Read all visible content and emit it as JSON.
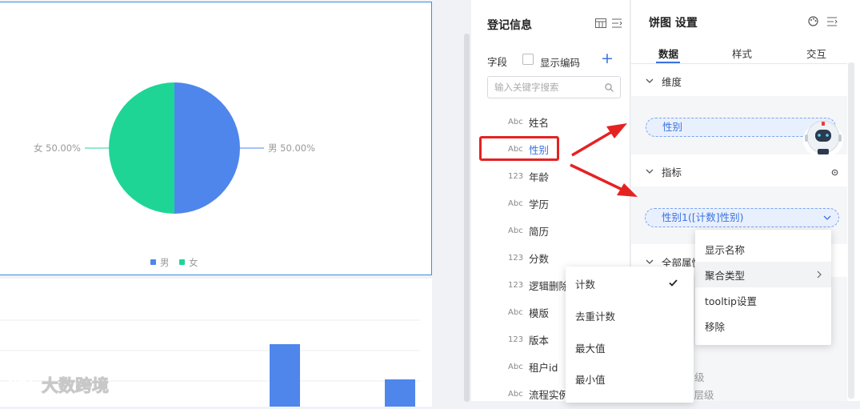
{
  "canvas": {
    "pie_chart": {
      "chart_data": {
        "type": "pie",
        "categories": [
          "男",
          "女"
        ],
        "values": [
          50,
          50
        ],
        "labels": [
          "男 50.00%",
          "女 50.00%"
        ],
        "colors": [
          "#4f86ec",
          "#1fd596"
        ],
        "legend_placement": "bottom",
        "legend": [
          "男",
          "女"
        ]
      }
    },
    "bar_chart": {
      "chart_data": {
        "type": "bar",
        "color": "#4f86ec",
        "note": "partially visible"
      }
    }
  },
  "field_panel": {
    "title": "登记信息",
    "section_label": "字段",
    "show_code_label": "显示编码",
    "search_placeholder": "输入关键字搜索",
    "fields": [
      {
        "type": "Abc",
        "name": "姓名"
      },
      {
        "type": "Abc",
        "name": "性别"
      },
      {
        "type": "123",
        "name": "年龄"
      },
      {
        "type": "Abc",
        "name": "学历"
      },
      {
        "type": "Abc",
        "name": "简历"
      },
      {
        "type": "123",
        "name": "分数"
      },
      {
        "type": "123",
        "name": "逻辑删除标"
      },
      {
        "type": "Abc",
        "name": "模版"
      },
      {
        "type": "123",
        "name": "版本"
      },
      {
        "type": "Abc",
        "name": "租户id"
      },
      {
        "type": "Abc",
        "name": "流程实例"
      }
    ]
  },
  "settings": {
    "title": "饼图 设置",
    "tabs": [
      "数据",
      "样式",
      "交互"
    ],
    "dimension_label": "维度",
    "dimension_value": "性别",
    "metric_label": "指标",
    "metric_value": "性别1([计数]性别)",
    "all_attrs_label": "全部属性",
    "partial_level_1": "级",
    "partial_level_2": "取层级"
  },
  "context_menu": {
    "items": [
      "显示名称",
      "聚合类型",
      "tooltip设置",
      "移除"
    ]
  },
  "agg_menu": {
    "items": [
      "计数",
      "去重计数",
      "最大值",
      "最小值"
    ],
    "selected": "计数"
  },
  "watermark": "大数跨境",
  "colors": {
    "accent": "#3a72e0",
    "highlight_box": "#e52222",
    "pie_male": "#4f86ec",
    "pie_female": "#1fd596"
  }
}
